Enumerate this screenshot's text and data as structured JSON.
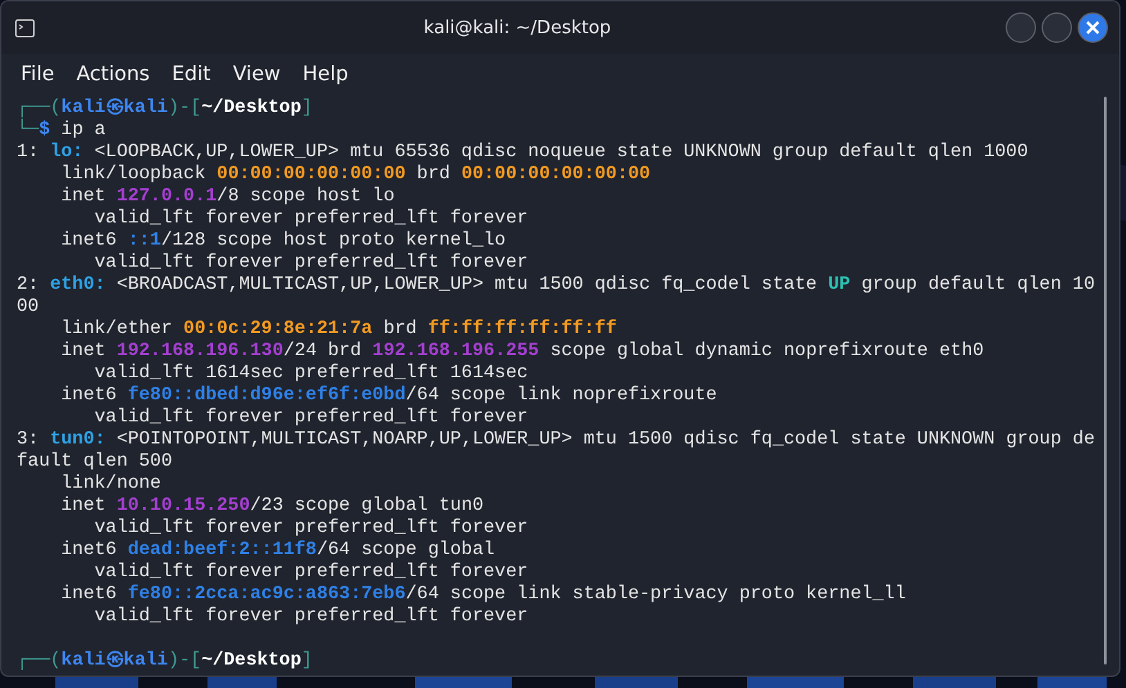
{
  "window": {
    "title": "kali@kali: ~/Desktop"
  },
  "menu": [
    "File",
    "Actions",
    "Edit",
    "View",
    "Help"
  ],
  "terminal": {
    "lines": [
      [
        {
          "kind": "punct",
          "text": "┌──("
        },
        {
          "kind": "user",
          "text": "kali㉿kali"
        },
        {
          "kind": "punct",
          "text": ")-["
        },
        {
          "kind": "path",
          "text": "~/Desktop"
        },
        {
          "kind": "punct",
          "text": "]"
        }
      ],
      [
        {
          "kind": "punct",
          "text": "└─"
        },
        {
          "kind": "user",
          "text": "$"
        },
        {
          "kind": "text",
          "text": " ip a"
        }
      ],
      [
        {
          "kind": "text",
          "text": "1: "
        },
        {
          "kind": "iface",
          "text": "lo:"
        },
        {
          "kind": "text",
          "text": " <LOOPBACK,UP,LOWER_UP> mtu 65536 qdisc noqueue state UNKNOWN group default qlen 1000"
        }
      ],
      [
        {
          "kind": "text",
          "text": "    link/loopback "
        },
        {
          "kind": "mac",
          "text": "00:00:00:00:00:00"
        },
        {
          "kind": "text",
          "text": " brd "
        },
        {
          "kind": "mac",
          "text": "00:00:00:00:00:00"
        }
      ],
      [
        {
          "kind": "text",
          "text": "    inet "
        },
        {
          "kind": "ipv4",
          "text": "127.0.0.1"
        },
        {
          "kind": "text",
          "text": "/8 scope host lo"
        }
      ],
      [
        {
          "kind": "text",
          "text": "       valid_lft forever preferred_lft forever"
        }
      ],
      [
        {
          "kind": "text",
          "text": "    inet6 "
        },
        {
          "kind": "ipv6",
          "text": "::1"
        },
        {
          "kind": "text",
          "text": "/128 scope host proto kernel_lo"
        }
      ],
      [
        {
          "kind": "text",
          "text": "       valid_lft forever preferred_lft forever"
        }
      ],
      [
        {
          "kind": "text",
          "text": "2: "
        },
        {
          "kind": "iface",
          "text": "eth0:"
        },
        {
          "kind": "text",
          "text": " <BROADCAST,MULTICAST,UP,LOWER_UP> mtu 1500 qdisc fq_codel state "
        },
        {
          "kind": "up",
          "text": "UP"
        },
        {
          "kind": "text",
          "text": " group default qlen 10"
        }
      ],
      [
        {
          "kind": "text",
          "text": "00"
        }
      ],
      [
        {
          "kind": "text",
          "text": "    link/ether "
        },
        {
          "kind": "mac",
          "text": "00:0c:29:8e:21:7a"
        },
        {
          "kind": "text",
          "text": " brd "
        },
        {
          "kind": "mac",
          "text": "ff:ff:ff:ff:ff:ff"
        }
      ],
      [
        {
          "kind": "text",
          "text": "    inet "
        },
        {
          "kind": "ipv4",
          "text": "192.168.196.130"
        },
        {
          "kind": "text",
          "text": "/24 brd "
        },
        {
          "kind": "ipv4",
          "text": "192.168.196.255"
        },
        {
          "kind": "text",
          "text": " scope global dynamic noprefixroute eth0"
        }
      ],
      [
        {
          "kind": "text",
          "text": "       valid_lft 1614sec preferred_lft 1614sec"
        }
      ],
      [
        {
          "kind": "text",
          "text": "    inet6 "
        },
        {
          "kind": "ipv6",
          "text": "fe80::dbed:d96e:ef6f:e0bd"
        },
        {
          "kind": "text",
          "text": "/64 scope link noprefixroute"
        }
      ],
      [
        {
          "kind": "text",
          "text": "       valid_lft forever preferred_lft forever"
        }
      ],
      [
        {
          "kind": "text",
          "text": "3: "
        },
        {
          "kind": "iface",
          "text": "tun0:"
        },
        {
          "kind": "text",
          "text": " <POINTOPOINT,MULTICAST,NOARP,UP,LOWER_UP> mtu 1500 qdisc fq_codel state UNKNOWN group de"
        }
      ],
      [
        {
          "kind": "text",
          "text": "fault qlen 500"
        }
      ],
      [
        {
          "kind": "text",
          "text": "    link/none"
        }
      ],
      [
        {
          "kind": "text",
          "text": "    inet "
        },
        {
          "kind": "ipv4",
          "text": "10.10.15.250"
        },
        {
          "kind": "text",
          "text": "/23 scope global tun0"
        }
      ],
      [
        {
          "kind": "text",
          "text": "       valid_lft forever preferred_lft forever"
        }
      ],
      [
        {
          "kind": "text",
          "text": "    inet6 "
        },
        {
          "kind": "ipv6",
          "text": "dead:beef:2::11f8"
        },
        {
          "kind": "text",
          "text": "/64 scope global"
        }
      ],
      [
        {
          "kind": "text",
          "text": "       valid_lft forever preferred_lft forever"
        }
      ],
      [
        {
          "kind": "text",
          "text": "    inet6 "
        },
        {
          "kind": "ipv6",
          "text": "fe80::2cca:ac9c:a863:7eb6"
        },
        {
          "kind": "text",
          "text": "/64 scope link stable-privacy proto kernel_ll"
        }
      ],
      [
        {
          "kind": "text",
          "text": "       valid_lft forever preferred_lft forever"
        }
      ],
      [
        {
          "kind": "punct",
          "text": "┌──("
        },
        {
          "kind": "user",
          "text": "kali㉿kali"
        },
        {
          "kind": "punct",
          "text": ")-["
        },
        {
          "kind": "path",
          "text": "~/Desktop"
        },
        {
          "kind": "punct",
          "text": "]"
        }
      ]
    ]
  }
}
